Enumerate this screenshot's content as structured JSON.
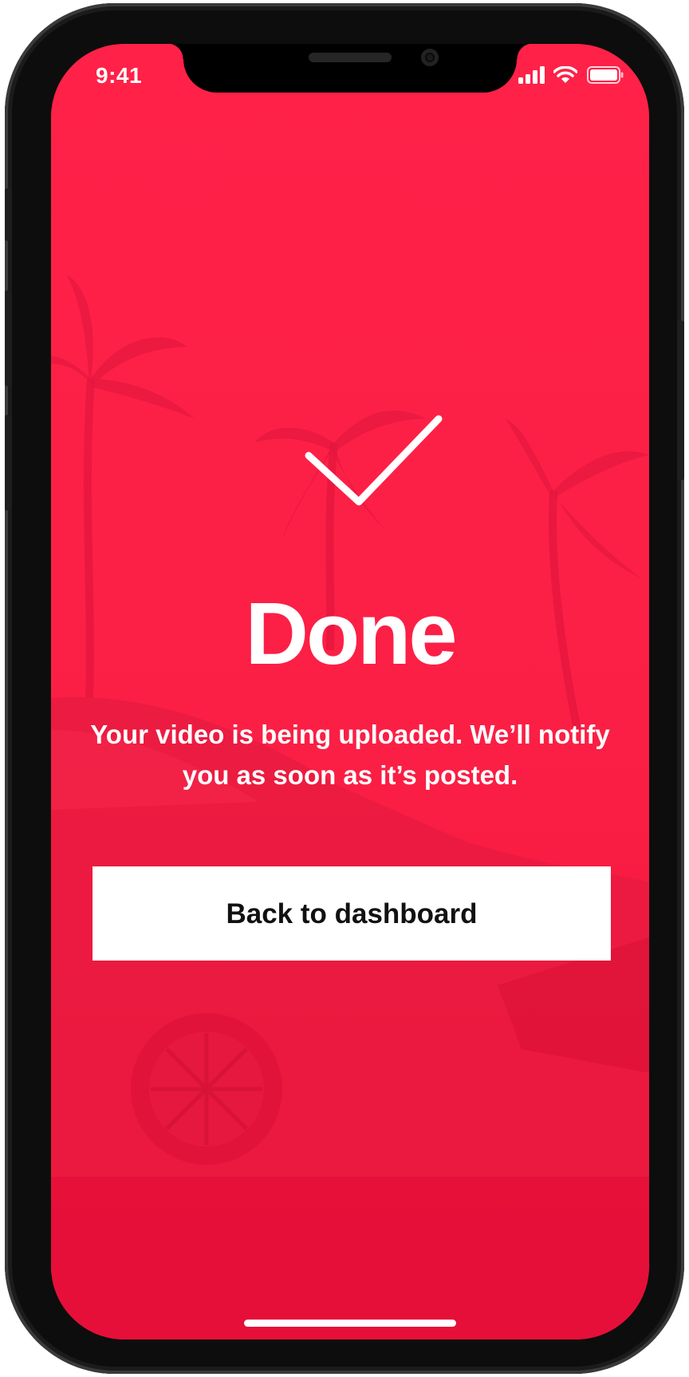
{
  "status_bar": {
    "time": "9:41",
    "icons": [
      "signal-icon",
      "wifi-icon",
      "battery-icon"
    ]
  },
  "confirmation": {
    "icon": "checkmark-icon",
    "title": "Done",
    "message": "Your video is being uploaded. We’ll notify you as soon as it’s posted."
  },
  "actions": {
    "back_label": "Back to dashboard"
  },
  "colors": {
    "background_accent": "#fb1e45",
    "button_background": "#ffffff",
    "button_text": "#111111",
    "text": "#ffffff"
  }
}
